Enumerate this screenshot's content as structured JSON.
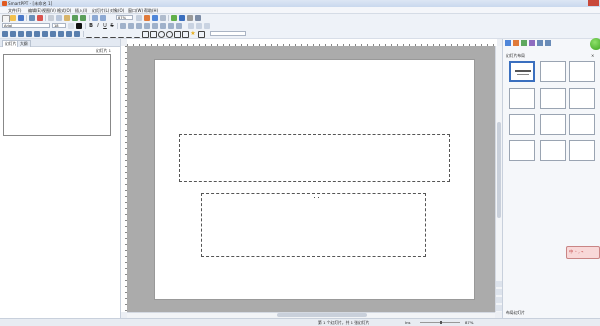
{
  "window": {
    "title": "SmartPPT - [未命名 1]"
  },
  "menu": [
    "文件(F)",
    "编辑(E)",
    "视图(V)",
    "格式(O)",
    "插入(I)",
    "幻灯片(L)",
    "对象(O)",
    "窗口(W)",
    "帮助(H)"
  ],
  "toolbar": {
    "zoom_value": "87%",
    "font_name": "Arial",
    "font_size": "18",
    "bold": "B",
    "italic": "I",
    "underline": "U",
    "strike": "S"
  },
  "left_panel": {
    "tabs": [
      "幻灯片",
      "大纲"
    ],
    "slide_label": "幻灯片 1"
  },
  "right_panel": {
    "title": "幻灯片布局",
    "layout_count": 12,
    "footer_label": "布局幻灯片"
  },
  "ime": {
    "label": "中 ◦ , ⌁"
  },
  "statusbar": {
    "slide_info": "第 1 个幻灯片，共 1 张幻灯片",
    "lang": "Ins",
    "zoom": "87%"
  },
  "colors": {
    "accent": "#3A6FBF",
    "workspace": "#ABABAB"
  }
}
